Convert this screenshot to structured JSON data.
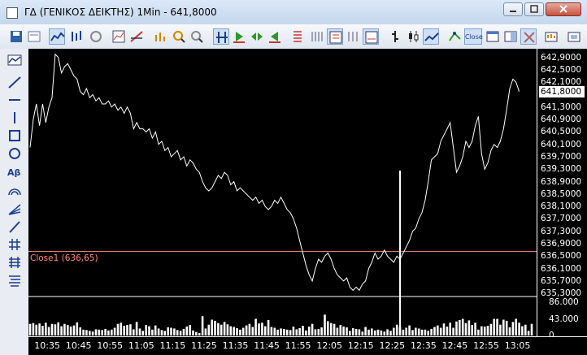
{
  "window": {
    "title": "ΓΔ (ΓΕΝΙΚΟΣ ΔΕΙΚΤΗΣ) 1Min - 641,8000"
  },
  "toolbar": {
    "icons": [
      "save-icon",
      "properties-icon",
      "line-chart-icon",
      "ohlc-chart-icon",
      "refresh-icon",
      "chart-type-icon",
      "draw-icon",
      "indicator-icon",
      "zoom-in-icon",
      "zoom-out-icon",
      "scale-icon",
      "play-icon",
      "step-icon",
      "end-icon",
      "list-icon",
      "tick-icon",
      "period-icon",
      "bars-icon",
      "ohlc-icon",
      "candles-icon",
      "line-icon",
      "connect-icon",
      "close-style-icon",
      "window-icon",
      "layout-icon",
      "tools-icon",
      "export-icon",
      "settings-icon"
    ],
    "close_label": "Close"
  },
  "y_axis": {
    "labels": [
      "642,9000",
      "642,5000",
      "642,1000",
      "641,8000",
      "641,3000",
      "640,9000",
      "640,5000",
      "640,1000",
      "639,7000",
      "639,3000",
      "638,9000",
      "638,5000",
      "638,1000",
      "637,7000",
      "637,3000",
      "636,9000",
      "636,5000",
      "636,1000",
      "635,7000",
      "635,3000"
    ],
    "current_price": "641,8000",
    "volume_labels": [
      "86.000",
      "43.000",
      "0"
    ]
  },
  "x_axis": {
    "labels": [
      "10:35",
      "10:45",
      "10:55",
      "11:05",
      "11:15",
      "11:25",
      "11:35",
      "11:45",
      "11:55",
      "12:05",
      "12:15",
      "12:25",
      "12:35",
      "12:45",
      "12:55",
      "13:05"
    ]
  },
  "close_line": {
    "label": "Close1 (636,65)",
    "value": 636.65,
    "color": "#ff8a80"
  },
  "chart_data": {
    "type": "line",
    "x": [
      "10:30",
      "10:31",
      "10:32",
      "10:33",
      "10:34",
      "10:35",
      "10:36",
      "10:37",
      "10:38",
      "10:39",
      "10:40",
      "10:41",
      "10:42",
      "10:43",
      "10:44",
      "10:45",
      "10:46",
      "10:47",
      "10:48",
      "10:49",
      "10:50",
      "10:51",
      "10:52",
      "10:53",
      "10:54",
      "10:55",
      "10:56",
      "10:57",
      "10:58",
      "10:59",
      "11:00",
      "11:01",
      "11:02",
      "11:03",
      "11:04",
      "11:05",
      "11:06",
      "11:07",
      "11:08",
      "11:09",
      "11:10",
      "11:11",
      "11:12",
      "11:13",
      "11:14",
      "11:15",
      "11:16",
      "11:17",
      "11:18",
      "11:19",
      "11:20",
      "11:21",
      "11:22",
      "11:23",
      "11:24",
      "11:25",
      "11:26",
      "11:27",
      "11:28",
      "11:29",
      "11:30",
      "11:31",
      "11:32",
      "11:33",
      "11:34",
      "11:35",
      "11:36",
      "11:37",
      "11:38",
      "11:39",
      "11:40",
      "11:41",
      "11:42",
      "11:43",
      "11:44",
      "11:45",
      "11:46",
      "11:47",
      "11:48",
      "11:49",
      "11:50",
      "11:51",
      "11:52",
      "11:53",
      "11:54",
      "11:55",
      "11:56",
      "11:57",
      "11:58",
      "11:59",
      "12:00",
      "12:01",
      "12:02",
      "12:03",
      "12:04",
      "12:05",
      "12:06",
      "12:07",
      "12:08",
      "12:09",
      "12:10",
      "12:11",
      "12:12",
      "12:13",
      "12:14",
      "12:15",
      "12:16",
      "12:17",
      "12:18",
      "12:19",
      "12:20",
      "12:21",
      "12:22",
      "12:23",
      "12:24",
      "12:25",
      "12:26",
      "12:27",
      "12:28",
      "12:29",
      "12:30",
      "12:31",
      "12:32",
      "12:33",
      "12:34",
      "12:35",
      "12:36",
      "12:37",
      "12:38",
      "12:39",
      "12:40",
      "12:41",
      "12:42",
      "12:43",
      "12:44",
      "12:45",
      "12:46",
      "12:47",
      "12:48",
      "12:49",
      "12:50",
      "12:51",
      "12:52",
      "12:53",
      "12:54",
      "12:55",
      "12:56",
      "12:57",
      "12:58",
      "12:59",
      "13:00",
      "13:01",
      "13:02",
      "13:03",
      "13:04",
      "13:05",
      "13:06",
      "13:07",
      "13:08",
      "13:09",
      "13:10"
    ],
    "close": [
      640.0,
      640.9,
      641.4,
      640.7,
      641.4,
      640.8,
      641.3,
      641.6,
      643.0,
      642.9,
      642.4,
      642.6,
      642.7,
      642.5,
      642.3,
      642.2,
      641.8,
      641.7,
      641.9,
      641.6,
      641.7,
      641.5,
      641.6,
      641.4,
      641.4,
      641.5,
      641.3,
      641.4,
      641.2,
      641.3,
      641.1,
      641.3,
      641.1,
      640.6,
      640.8,
      640.6,
      640.6,
      640.5,
      640.6,
      640.3,
      640.5,
      640.1,
      640.2,
      639.9,
      640.0,
      639.7,
      639.8,
      639.9,
      639.6,
      639.7,
      639.4,
      639.6,
      639.5,
      639.3,
      639.2,
      638.9,
      638.7,
      638.6,
      638.7,
      638.9,
      639.1,
      639.0,
      639.2,
      639.1,
      638.8,
      638.9,
      638.6,
      638.7,
      638.6,
      638.5,
      638.4,
      638.3,
      638.4,
      638.2,
      638.3,
      638.1,
      638.0,
      638.1,
      638.3,
      638.2,
      638.4,
      638.2,
      638.0,
      637.9,
      637.7,
      637.4,
      637.0,
      636.6,
      636.2,
      635.9,
      635.7,
      636.1,
      636.4,
      636.3,
      636.5,
      636.6,
      636.4,
      636.1,
      635.9,
      635.8,
      635.7,
      635.8,
      635.5,
      635.4,
      635.5,
      635.4,
      635.6,
      635.7,
      636.1,
      636.3,
      636.6,
      636.4,
      636.5,
      636.7,
      636.5,
      636.4,
      636.3,
      636.5,
      636.4,
      636.6,
      636.8,
      637.0,
      637.3,
      637.4,
      637.7,
      637.9,
      638.3,
      638.9,
      639.6,
      639.7,
      639.8,
      640.2,
      640.4,
      640.6,
      640.8,
      640.0,
      639.2,
      639.4,
      639.7,
      640.2,
      640.0,
      640.2,
      640.7,
      641.0,
      639.8,
      639.3,
      639.5,
      639.9,
      640.1,
      640.0,
      640.2,
      640.6,
      641.2,
      641.9,
      642.2,
      642.1,
      641.8
    ],
    "volume_ylim": [
      0,
      86000
    ],
    "volume_ticks": [
      0,
      43000,
      86000
    ],
    "volume": [
      30000,
      32000,
      28000,
      31000,
      25000,
      33000,
      22000,
      30000,
      29000,
      34000,
      24000,
      30000,
      27000,
      23000,
      26000,
      34000,
      21000,
      15000,
      14000,
      12000,
      10000,
      16000,
      15000,
      14000,
      17000,
      13000,
      15000,
      20000,
      30000,
      33000,
      25000,
      27000,
      29000,
      16000,
      35000,
      18000,
      12000,
      27000,
      24000,
      15000,
      26000,
      18000,
      14000,
      12000,
      21000,
      20000,
      18000,
      14000,
      12000,
      17000,
      23000,
      27000,
      13000,
      9000,
      6000,
      50000,
      18000,
      28000,
      41000,
      38000,
      32000,
      28000,
      35000,
      29000,
      24000,
      22000,
      19000,
      15000,
      20000,
      26000,
      30000,
      22000,
      43000,
      31000,
      33000,
      24000,
      40000,
      22000,
      20000,
      15000,
      18000,
      17000,
      15000,
      14000,
      23000,
      16000,
      19000,
      25000,
      13000,
      23000,
      30000,
      16000,
      17000,
      21000,
      54000,
      37000,
      32000,
      30000,
      20000,
      27000,
      23000,
      21000,
      12000,
      19000,
      17000,
      16000,
      10000,
      22000,
      15000,
      18000,
      13000,
      15000,
      13000,
      10000,
      16000,
      12000,
      20000,
      28000,
      22000,
      15000,
      20000,
      26000,
      14000,
      20000,
      18000,
      15000,
      15000,
      12000,
      17000,
      22000,
      26000,
      20000,
      31000,
      23000,
      33000,
      20000,
      36000,
      40000,
      43000,
      32000,
      39000,
      27000,
      33000,
      15000,
      24000,
      23000,
      25000,
      30000,
      43000,
      43000,
      28000,
      41000,
      38000,
      21000,
      35000,
      43000,
      33000,
      24000,
      28000,
      12000,
      30000
    ],
    "big_volume": [
      {
        "x": "12:28",
        "value": 500000
      }
    ],
    "ylim": [
      635.2,
      643.1
    ],
    "y_ticks": [
      642.9,
      642.5,
      642.1,
      641.8,
      641.3,
      640.9,
      640.5,
      640.1,
      639.7,
      639.3,
      638.9,
      638.5,
      638.1,
      637.7,
      637.3,
      636.9,
      636.5,
      636.1,
      635.7,
      635.3
    ],
    "close_level": 636.65,
    "grid": false
  }
}
